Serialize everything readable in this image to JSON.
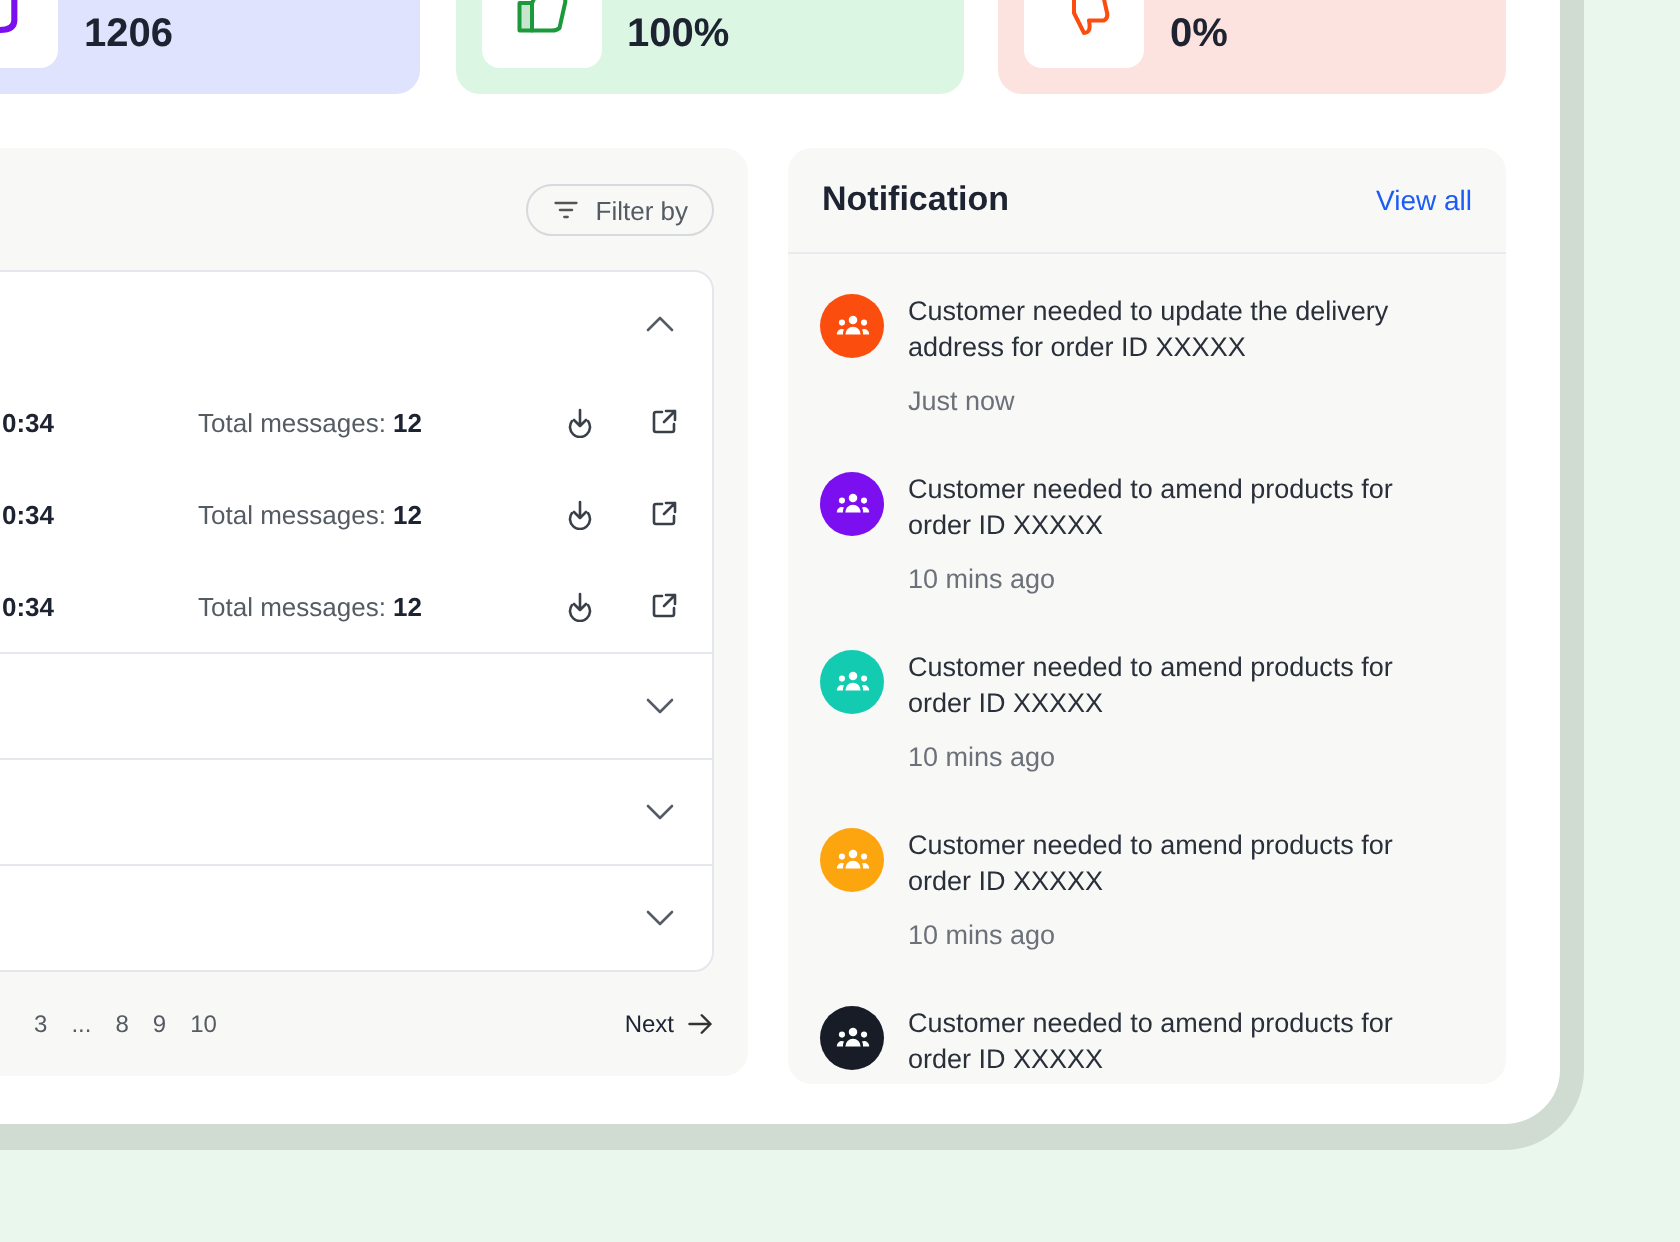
{
  "stats": [
    {
      "value": "1206",
      "color": "#e0e3fd"
    },
    {
      "value": "100%",
      "color": "#dcf6e4"
    },
    {
      "value": "0%",
      "color": "#fde3df"
    }
  ],
  "messages_panel": {
    "filter_button": "Filter by",
    "groups": [
      {
        "expanded": true,
        "rows": [
          {
            "time": "0:34",
            "total": "Total messages: **12**"
          },
          {
            "time": "0:34",
            "total": "Total messages: **12**"
          },
          {
            "time": "0:34",
            "total": "Total messages: **12**"
          }
        ]
      },
      {
        "expanded": false
      },
      {
        "expanded": false
      },
      {
        "expanded": false
      }
    ],
    "pagination": {
      "pages": [
        "3",
        "...",
        "8",
        "9",
        "10"
      ],
      "next": "Next"
    }
  },
  "notifications": {
    "title": "Notification",
    "view_all": "View all",
    "items": [
      {
        "text": "Customer needed to update the delivery address for order ID XXXXX",
        "time": "Just now",
        "color": "#fb4d0e"
      },
      {
        "text": "Customer needed to amend products for order ID XXXXX",
        "time": "10 mins ago",
        "color": "#7b0ff0"
      },
      {
        "text": "Customer needed to amend products for order ID XXXXX",
        "time": "10 mins ago",
        "color": "#12cbb1"
      },
      {
        "text": "Customer needed to amend products for order ID XXXXX",
        "time": "10 mins ago",
        "color": "#fda50f"
      },
      {
        "text": "Customer needed to amend products for order ID XXXXX",
        "color": "#171c26"
      }
    ]
  }
}
